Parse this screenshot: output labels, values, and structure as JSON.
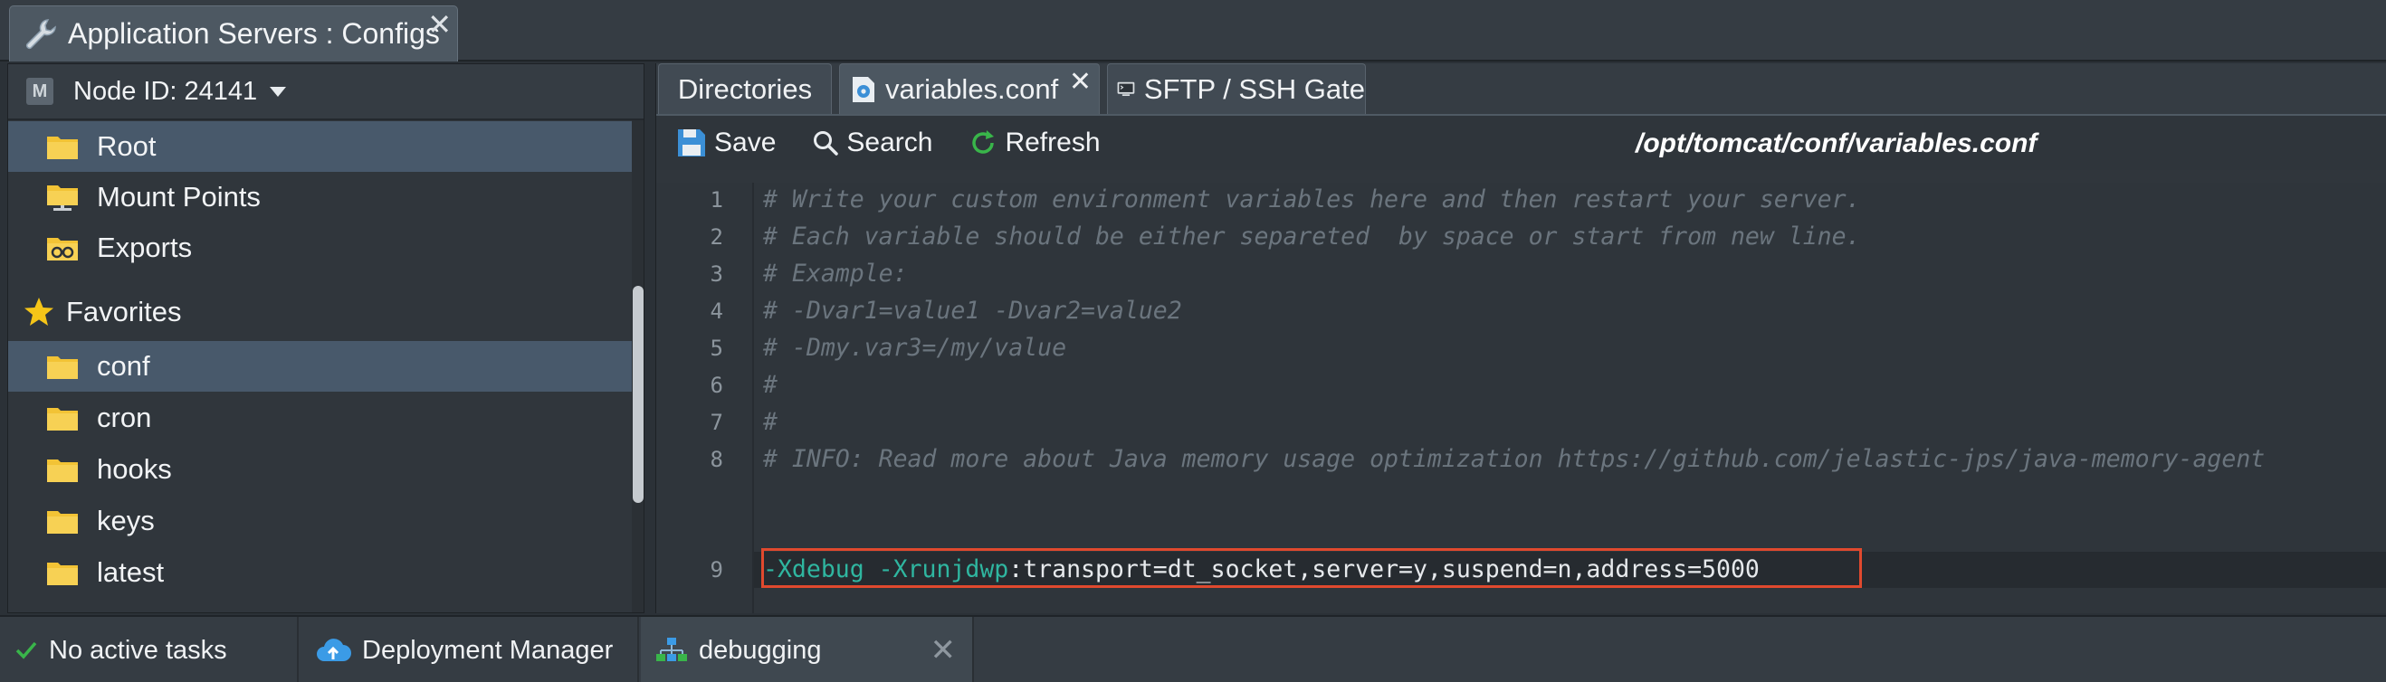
{
  "window": {
    "title": "Application Servers : Configs",
    "close": "✕"
  },
  "left_panel": {
    "node_badge": "M",
    "node_label": "Node ID: 24141",
    "tree": [
      {
        "label": "Root",
        "selected": true,
        "icon": "folder-icon"
      },
      {
        "label": "Mount Points",
        "selected": false,
        "icon": "mount-points-icon"
      },
      {
        "label": "Exports",
        "selected": false,
        "icon": "exports-icon"
      }
    ],
    "favorites_label": "Favorites",
    "favorites": [
      {
        "label": "conf",
        "selected": true
      },
      {
        "label": "cron",
        "selected": false
      },
      {
        "label": "hooks",
        "selected": false
      },
      {
        "label": "keys",
        "selected": false
      },
      {
        "label": "latest",
        "selected": false
      }
    ]
  },
  "right_panel": {
    "tabs": [
      {
        "label": "Directories",
        "active": false
      },
      {
        "label": "variables.conf",
        "active": true,
        "close": "✕"
      },
      {
        "label": "SFTP / SSH Gate",
        "active": false
      }
    ],
    "toolbar": {
      "save_label": "Save",
      "search_label": "Search",
      "refresh_label": "Refresh",
      "file_path": "/opt/tomcat/conf/variables.conf"
    },
    "editor": {
      "line_numbers": [
        "1",
        "2",
        "3",
        "4",
        "5",
        "6",
        "7",
        "8",
        "9"
      ],
      "comment_lines": [
        "# Write your custom environment variables here and then restart your server.",
        "# Each variable should be either separeted  by space or start from new line.",
        "# Example:",
        "# -Dvar1=value1 -Dvar2=value2",
        "# -Dmy.var3=/my/value",
        "#",
        "#",
        "# INFO: Read more about Java memory usage optimization https://github.com/jelastic-jps/java-memory-agent"
      ],
      "line9": {
        "part1": "-Xdebug",
        "space": " ",
        "part2": "-Xrunjdwp",
        "part3": ":transport=dt_socket,server=y,suspend=n,address=5000"
      }
    }
  },
  "statusbar": {
    "tasks_label": "No active tasks",
    "deployment_label": "Deployment Manager",
    "debug_label": "debugging",
    "debug_close": "✕"
  },
  "colors": {
    "highlight_border": "#e0492e",
    "keyword": "#2fb6a0",
    "selected_row": "#48596b",
    "folder": "#f2c335"
  }
}
